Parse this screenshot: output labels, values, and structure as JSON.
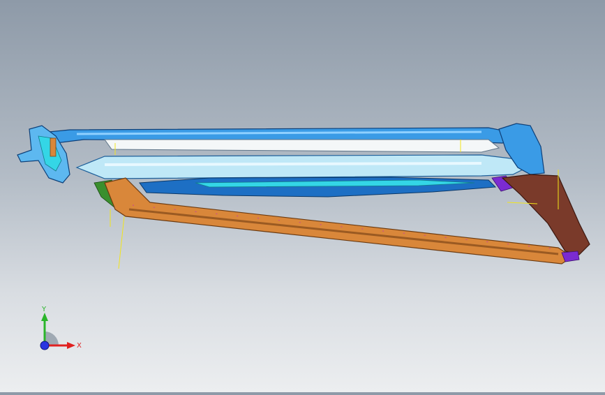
{
  "viewport": {
    "background_top": "#8e9aa8",
    "background_bottom": "#eceef0"
  },
  "model": {
    "colors": {
      "blue_dark": "#1d6fc4",
      "blue_light": "#5db8f0",
      "cyan": "#34d6e6",
      "white_part": "#f4f7f8",
      "orange_rail": "#d9873a",
      "orange_dark": "#9a5a22",
      "purple": "#7b2bd1",
      "brown": "#7a3a2a",
      "green": "#3a8f2e",
      "sketch_yellow": "#f2e51a"
    }
  },
  "triad": {
    "x_label": "X",
    "y_label": "Y",
    "x_color": "#e02020",
    "y_color": "#2ab52a",
    "z_color": "#2a35e0"
  }
}
